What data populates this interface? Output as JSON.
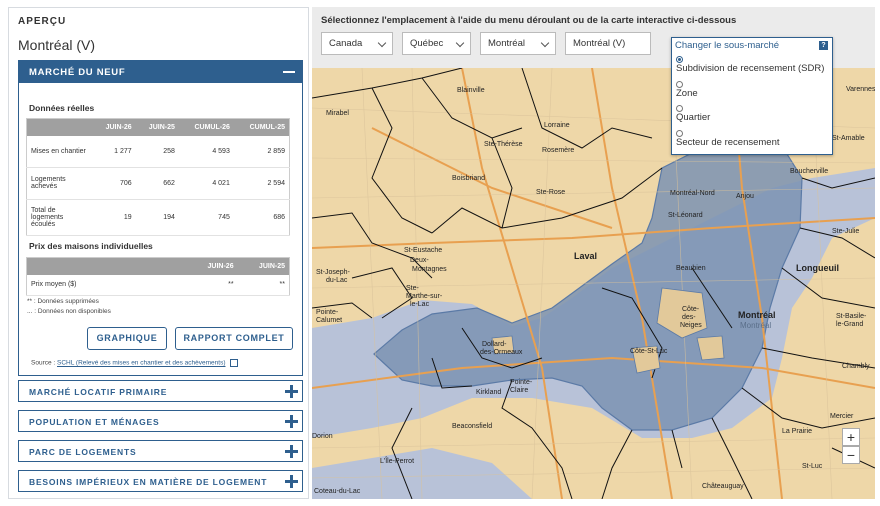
{
  "sidebar": {
    "title": "APERÇU",
    "geo_name": "Montréal (V)",
    "open_section": {
      "title": "MARCHÉ DU NEUF",
      "real_data_title": "Données réelles",
      "table1": {
        "headers": [
          "",
          "JUIN-26",
          "JUIN-25",
          "CUMUL-26",
          "CUMUL-25"
        ],
        "rows": [
          {
            "label": "Mises en chantier",
            "values": [
              "1 277",
              "258",
              "4 593",
              "2 859"
            ]
          },
          {
            "label": "Logements achevés",
            "values": [
              "706",
              "662",
              "4 021",
              "2 594"
            ]
          },
          {
            "label": "Total de logements écoulés",
            "values": [
              "19",
              "194",
              "745",
              "686"
            ]
          }
        ]
      },
      "price_title": "Prix des maisons individuelles",
      "table2": {
        "headers": [
          "",
          "JUIN-26",
          "JUIN-25"
        ],
        "rows": [
          {
            "label": "Prix moyen ($)",
            "values": [
              "**",
              "**"
            ]
          }
        ]
      },
      "note1": "** : Données supprimées",
      "note2": "... : Données non disponibles",
      "btn_graph": "GRAPHIQUE",
      "btn_report": "RAPPORT COMPLET",
      "source_prefix": "Source : ",
      "source_link": "SCHL (Relevé des mises en chantier et des achèvements)"
    },
    "closed_sections": [
      "MARCHÉ LOCATIF PRIMAIRE",
      "POPULATION ET MÉNAGES",
      "PARC DE LOGEMENTS",
      "BESOINS IMPÉRIEUX EN MATIÈRE DE LOGEMENT"
    ]
  },
  "main": {
    "instruction": "Sélectionnez l'emplacement à l'aide du menu déroulant ou de la carte interactive ci-dessous",
    "dropdowns": [
      "Canada",
      "Québec",
      "Montréal",
      "Montréal (V)"
    ]
  },
  "popup": {
    "title": "Changer le sous-marché",
    "help": "?",
    "options": [
      {
        "label": "Subdivision de recensement (SDR)",
        "selected": true
      },
      {
        "label": "Zone",
        "selected": false
      },
      {
        "label": "Quartier",
        "selected": false
      },
      {
        "label": "Secteur de recensement",
        "selected": false
      }
    ]
  },
  "map": {
    "zoom_in": "+",
    "zoom_out": "−",
    "labels": [
      "Blainville",
      "Mirabel",
      "Lorraine",
      "Ste-Thérèse",
      "Rosemère",
      "Boisbriand",
      "Ste-Rose",
      "Laval",
      "St-Eustache",
      "Deux-Montagnes",
      "St-Joseph-du-Lac",
      "Ste-Marthe-sur-le-Lac",
      "Pointe-Calumet",
      "Montréal-Nord",
      "St-Léonard",
      "Anjou",
      "Beaubien",
      "Côte-des-Neiges",
      "Côte-St-Luc",
      "Montréal",
      "Montréal",
      "Dollard-des-Ormeaux",
      "Kirkland",
      "Pointe-Claire",
      "Beaconsfield",
      "L'Île-Perrot",
      "Dorion",
      "Longueuil",
      "Boucherville",
      "Varennes",
      "St-Amable",
      "Mercier",
      "Ste-Julie",
      "St-Basile-le-Grand",
      "Chambly",
      "La Prairie",
      "St-Luc",
      "Coteau-du-Lac",
      "Châteauguay"
    ],
    "colors": {
      "land": "#eed7a8",
      "water": "#b8c2d8",
      "highlight": "#7b93b3",
      "highlight_stroke": "#5b7aa6",
      "highway": "#e8a050",
      "boundary": "#111111"
    }
  },
  "colors": {
    "accent": "#2e5f8e",
    "panel_bg": "#ebebeb"
  }
}
